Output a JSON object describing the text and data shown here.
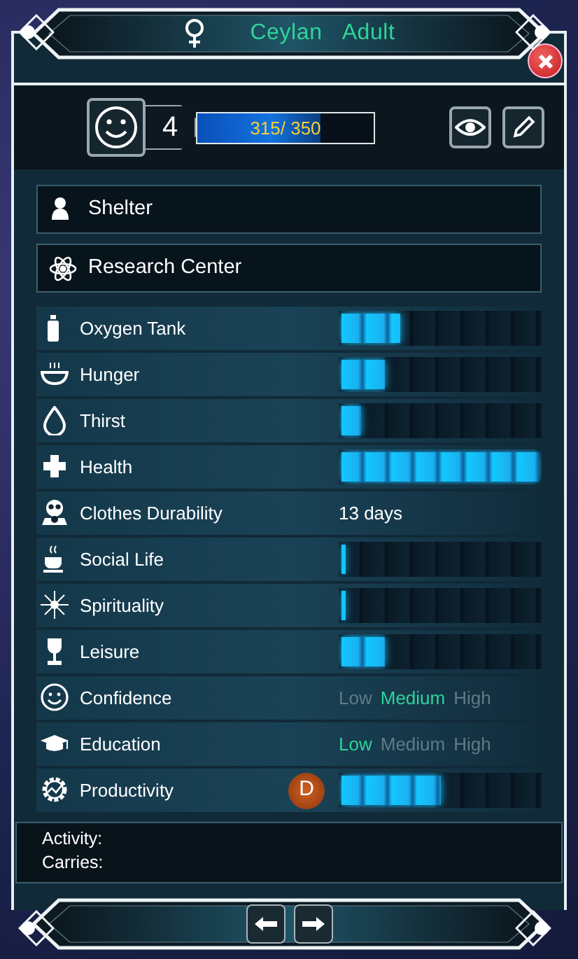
{
  "header": {
    "name": "Ceylan",
    "age_group": "Adult"
  },
  "level": {
    "value": "4",
    "xp": "315/ 350",
    "level": 0.7
  },
  "locations": [
    {
      "label": "Shelter"
    },
    {
      "label": "Research Center"
    }
  ],
  "stats": [
    {
      "kind": "bar",
      "label": "Oxygen Tank",
      "level": 0.3
    },
    {
      "kind": "bar",
      "label": "Hunger",
      "level": 0.22
    },
    {
      "kind": "bar",
      "label": "Thirst",
      "level": 0.1
    },
    {
      "kind": "bar",
      "label": "Health",
      "level": 1
    },
    {
      "kind": "text",
      "label": "Clothes Durability",
      "value": "13  days"
    },
    {
      "kind": "bar",
      "label": "Social Life",
      "level": 0.02
    },
    {
      "kind": "bar",
      "label": "Spirituality",
      "level": 0.02
    },
    {
      "kind": "bar",
      "label": "Leisure",
      "level": 0.22
    },
    {
      "kind": "choice",
      "label": "Confidence",
      "options": [
        {
          "label": "Low",
          "selected": false
        },
        {
          "label": "Medium",
          "selected": true
        },
        {
          "label": "High",
          "selected": false
        }
      ]
    },
    {
      "kind": "choice",
      "label": "Education",
      "options": [
        {
          "label": "Low",
          "selected": true
        },
        {
          "label": "Medium",
          "selected": false
        },
        {
          "label": "High",
          "selected": false
        }
      ]
    },
    {
      "kind": "bar",
      "label": "Productivity",
      "grade": "D",
      "level": 0.5
    }
  ],
  "info": {
    "activity_label": "Activity:",
    "carries_label": "Carries:"
  }
}
